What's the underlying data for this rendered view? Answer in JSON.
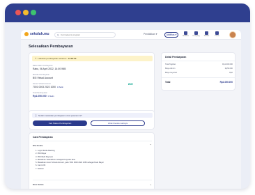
{
  "window": {
    "controls": [
      "close",
      "minimize",
      "maximize"
    ]
  },
  "header": {
    "logo": "sekolah.mu",
    "search_placeholder": "Cari kelas & program",
    "nav_link": "Pendidikan",
    "nav_button": "Aktifitas",
    "icons": [
      {
        "name": "bell-icon",
        "label": "Notifikasi"
      },
      {
        "name": "cart-icon",
        "label": "Keranjang"
      },
      {
        "name": "heart-icon",
        "label": "Wishlist"
      },
      {
        "name": "chat-icon",
        "label": "Pesan"
      }
    ]
  },
  "page": {
    "title": "Selesaikan Pembayaran"
  },
  "payment": {
    "warning_prefix": "Lakukan pembayaran sebelum",
    "warning_time": "14:00:00",
    "deadline_label": "Batas Akhir Pembayaran",
    "deadline_value": "Rabu, 06 April 2022, 14:00 WIB",
    "method_label": "Metode Pembayaran",
    "method_value": "BSI Virtual Account",
    "bank_logo": "BSI",
    "va_label": "Nomor Virtual Account",
    "va_value": "7001 0003 2022 1050",
    "copy_label": "Salin",
    "total_label": "Total Pembayaran",
    "total_value": "Rp1.050.000",
    "copy_label2": "Salin"
  },
  "confirm": {
    "note": "Sudah melakukan pembayaran untuk pesanan ini?",
    "primary_button": "Cek Status Pembayaran",
    "secondary_button": "Lihat Invoice Lainnya"
  },
  "howto": {
    "title": "Cara Pembayaran",
    "sections": [
      {
        "label": "BSI Mobile",
        "expanded": true
      },
      {
        "label": "BCA Mobile",
        "expanded": false
      }
    ],
    "steps": [
      "1. Login Mobile Banking",
      "2. Pilih Bayar",
      "3. Pilih Multi Payment",
      "4. Masukkan 'Sekolahmu' sebagai Penyedia Jasa",
      "5. Masukkan nomor Virtual Account, yaitu 7001 0003 2022 1050 sebagai Kode Bayar",
      "6. Cek & OK",
      "7. Selesai"
    ]
  },
  "summary": {
    "title": "Detail Pembayaran",
    "rows": [
      {
        "label": "Total Tagihan",
        "value": "Rp1.000.000"
      },
      {
        "label": "Biaya Admin",
        "value": "Rp50.000"
      },
      {
        "label": "Biaya Layanan",
        "value": "Rp0"
      }
    ],
    "total_label": "Total",
    "total_value": "Rp1.050.000"
  },
  "colors": {
    "titlebar": "#2f3f8f",
    "primary": "#2b3a8c",
    "warning_bg": "#fdf3c9",
    "bsi": "#0aa58f"
  }
}
